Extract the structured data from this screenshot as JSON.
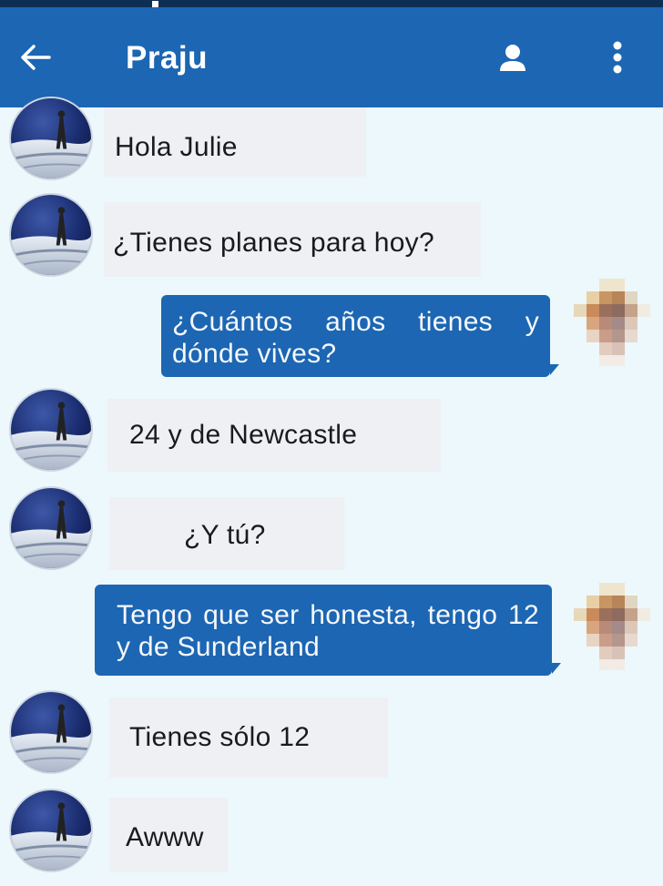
{
  "header": {
    "title": "Praju",
    "back_icon": "arrow-left-icon",
    "profile_icon": "person-icon",
    "menu_icon": "more-vert-icon"
  },
  "colors": {
    "app_bar": "#1c66b3",
    "status_bar": "#0e2f55",
    "background": "#ecf8fb",
    "incoming_bubble": "#eef0f4",
    "outgoing_bubble": "#1c66b3"
  },
  "messages": [
    {
      "direction": "incoming",
      "text": "Hola Julie"
    },
    {
      "direction": "incoming",
      "text": "¿Tienes planes para hoy?"
    },
    {
      "direction": "outgoing",
      "text": "¿Cuántos años tienes y dónde vives?"
    },
    {
      "direction": "incoming",
      "text": "24 y de Newcastle"
    },
    {
      "direction": "incoming",
      "text": "¿Y tú?"
    },
    {
      "direction": "outgoing",
      "text": "Tengo que ser honesta, tengo 12 y de Sunderland"
    },
    {
      "direction": "incoming",
      "text": "Tienes sólo 12"
    },
    {
      "direction": "incoming",
      "text": "Awww"
    }
  ]
}
